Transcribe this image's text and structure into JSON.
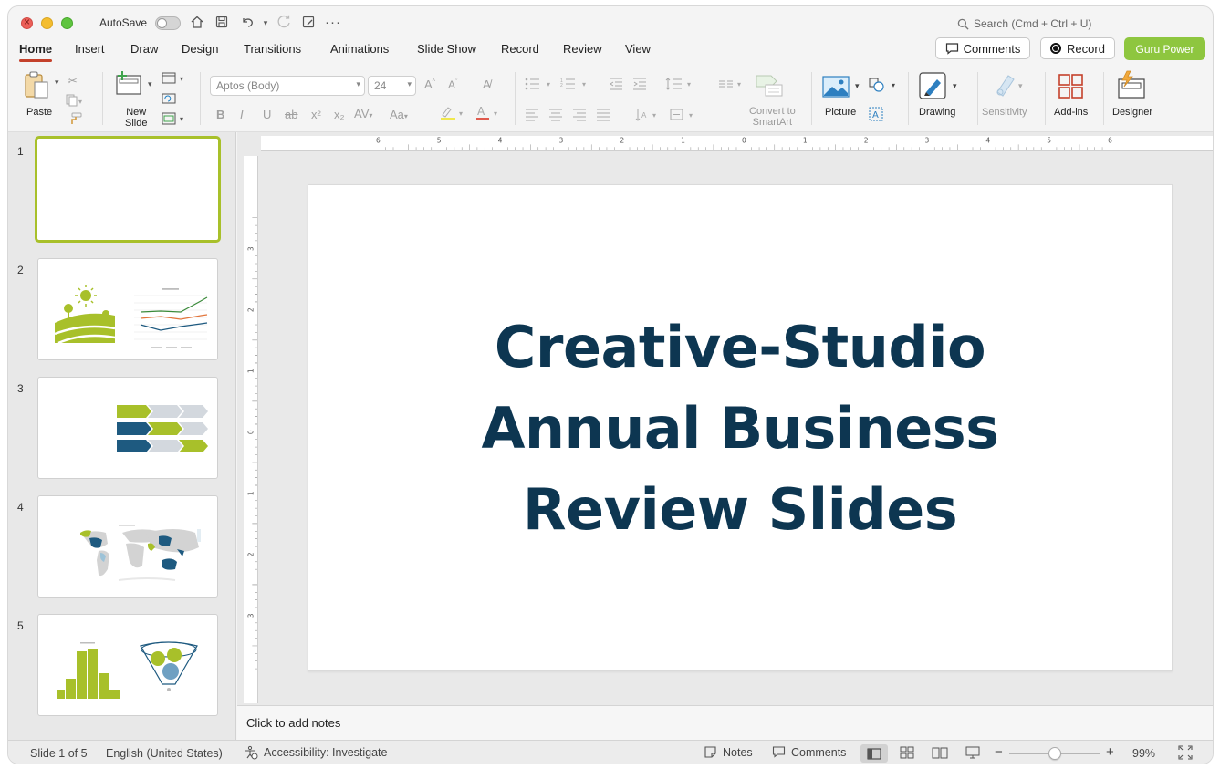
{
  "titlebar": {
    "autosave_label": "AutoSave",
    "search_placeholder": "Search (Cmd + Ctrl + U)"
  },
  "tabs": [
    {
      "label": "Home",
      "active": true
    },
    {
      "label": "Insert"
    },
    {
      "label": "Draw"
    },
    {
      "label": "Design"
    },
    {
      "label": "Transitions"
    },
    {
      "label": "Animations"
    },
    {
      "label": "Slide Show"
    },
    {
      "label": "Record"
    },
    {
      "label": "Review"
    },
    {
      "label": "View"
    }
  ],
  "header_buttons": {
    "comments": "Comments",
    "record": "Record",
    "guru": "Guru Power"
  },
  "ribbon": {
    "paste": "Paste",
    "new_slide_line1": "New",
    "new_slide_line2": "Slide",
    "font_name": "Aptos (Body)",
    "font_size": "24",
    "convert_line1": "Convert to",
    "convert_line2": "SmartArt",
    "picture": "Picture",
    "drawing": "Drawing",
    "sensitivity": "Sensitivity",
    "addins": "Add-ins",
    "designer": "Designer"
  },
  "thumbnails": [
    {
      "number": "1"
    },
    {
      "number": "2"
    },
    {
      "number": "3"
    },
    {
      "number": "4"
    },
    {
      "number": "5"
    }
  ],
  "slide": {
    "title_line1": "Creative-Studio",
    "title_line2": "Annual Business",
    "title_line3": "Review Slides"
  },
  "ruler": {
    "h_labels": [
      "6",
      "5",
      "4",
      "3",
      "2",
      "1",
      "0",
      "1",
      "2",
      "3",
      "4",
      "5",
      "6"
    ],
    "v_labels": [
      "3",
      "2",
      "1",
      "0",
      "1",
      "2",
      "3"
    ]
  },
  "notes_placeholder": "Click to add notes",
  "status": {
    "slide_count": "Slide 1 of 5",
    "language": "English (United States)",
    "accessibility": "Accessibility: Investigate",
    "notes": "Notes",
    "comments": "Comments",
    "zoom": "99%",
    "zoom_level": 0.5
  },
  "colors": {
    "accent": "#c4412b",
    "guru_green": "#8ec63f",
    "title_navy": "#0d3651",
    "thumb_green": "#a8c02a",
    "thumb_blue": "#1e5a80"
  }
}
